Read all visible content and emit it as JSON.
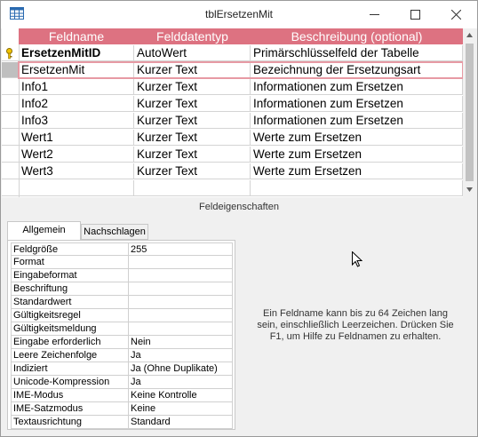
{
  "window": {
    "title": "tblErsetzenMit"
  },
  "grid": {
    "headers": [
      "Feldname",
      "Felddatentyp",
      "Beschreibung (optional)"
    ],
    "rows": [
      {
        "name": "ErsetzenMitID",
        "type": "AutoWert",
        "desc": "Primärschlüsselfeld der Tabelle",
        "primary_key": true
      },
      {
        "name": "ErsetzenMit",
        "type": "Kurzer Text",
        "desc": "Bezeichnung der Ersetzungsart",
        "current": true
      },
      {
        "name": "Info1",
        "type": "Kurzer Text",
        "desc": "Informationen zum Ersetzen"
      },
      {
        "name": "Info2",
        "type": "Kurzer Text",
        "desc": "Informationen zum Ersetzen"
      },
      {
        "name": "Info3",
        "type": "Kurzer Text",
        "desc": "Informationen zum Ersetzen"
      },
      {
        "name": "Wert1",
        "type": "Kurzer Text",
        "desc": "Werte zum Ersetzen"
      },
      {
        "name": "Wert2",
        "type": "Kurzer Text",
        "desc": "Werte zum Ersetzen"
      },
      {
        "name": "Wert3",
        "type": "Kurzer Text",
        "desc": "Werte zum Ersetzen"
      },
      {
        "name": "",
        "type": "",
        "desc": ""
      }
    ],
    "header_color": "#dd7281"
  },
  "properties": {
    "caption": "Feldeigenschaften",
    "tabs": [
      "Allgemein",
      "Nachschlagen"
    ],
    "active_tab": "Allgemein",
    "rows": [
      {
        "name": "Feldgröße",
        "value": "255"
      },
      {
        "name": "Format",
        "value": ""
      },
      {
        "name": "Eingabeformat",
        "value": ""
      },
      {
        "name": "Beschriftung",
        "value": ""
      },
      {
        "name": "Standardwert",
        "value": ""
      },
      {
        "name": "Gültigkeitsregel",
        "value": ""
      },
      {
        "name": "Gültigkeitsmeldung",
        "value": ""
      },
      {
        "name": "Eingabe erforderlich",
        "value": "Nein"
      },
      {
        "name": "Leere Zeichenfolge",
        "value": "Ja"
      },
      {
        "name": "Indiziert",
        "value": "Ja (Ohne Duplikate)"
      },
      {
        "name": "Unicode-Kompression",
        "value": "Ja"
      },
      {
        "name": "IME-Modus",
        "value": "Keine Kontrolle"
      },
      {
        "name": "IME-Satzmodus",
        "value": "Keine"
      },
      {
        "name": "Textausrichtung",
        "value": "Standard"
      }
    ],
    "help_lines": [
      "Ein Feldname kann bis zu 64 Zeichen lang",
      "sein, einschließlich Leerzeichen. Drücken Sie",
      "F1, um Hilfe zu Feldnamen zu erhalten."
    ]
  },
  "icons": [
    "table-icon",
    "minimize-icon",
    "maximize-icon",
    "close-icon",
    "primary-key-icon",
    "scroll-up-icon",
    "scroll-down-icon",
    "mouse-pointer-icon"
  ]
}
